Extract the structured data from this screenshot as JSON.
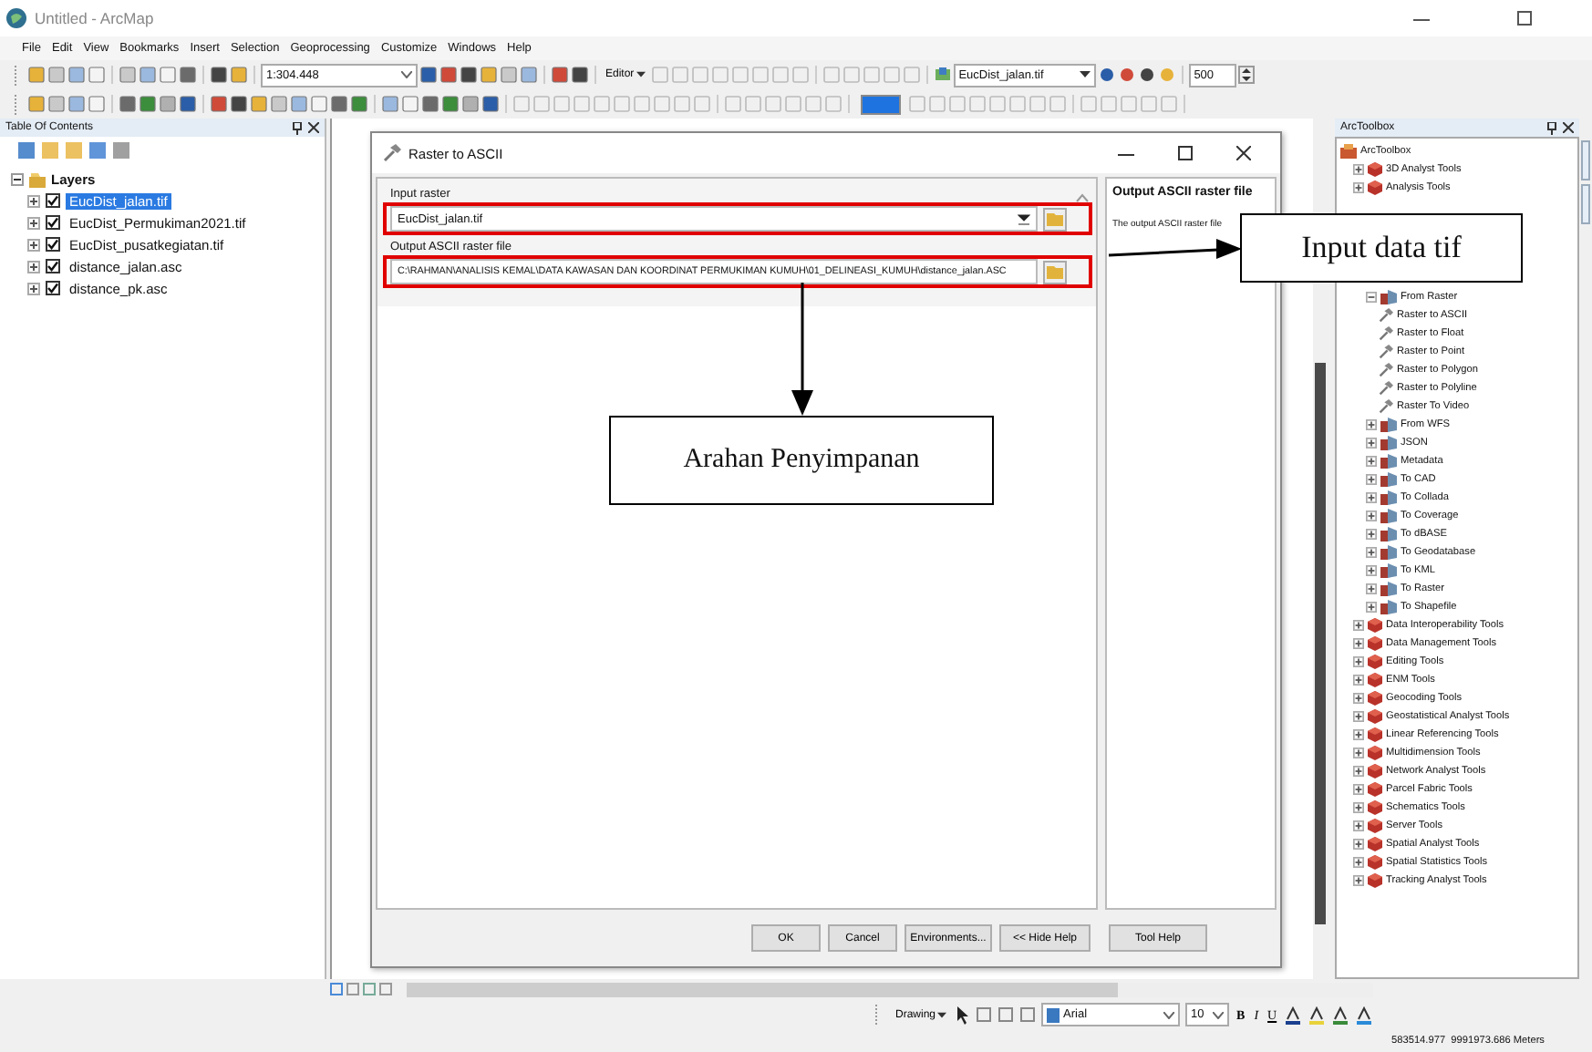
{
  "window": {
    "title": "Untitled - ArcMap"
  },
  "menu": [
    "File",
    "Edit",
    "View",
    "Bookmarks",
    "Insert",
    "Selection",
    "Geoprocessing",
    "Customize",
    "Windows",
    "Help"
  ],
  "toolbar": {
    "scale": "1:304.448",
    "editor": "Editor",
    "layer": "EucDist_jalan.tif",
    "value": "500"
  },
  "table_of_contents": {
    "title": "Table Of Contents",
    "group": {
      "label": "Layers",
      "expanded": true,
      "children": [
        {
          "label": "EucDist_jalan.tif",
          "checked": true,
          "selected": true
        },
        {
          "label": "EucDist_Permukiman2021.tif",
          "checked": true,
          "selected": false
        },
        {
          "label": "EucDist_pusatkegiatan.tif",
          "checked": true,
          "selected": false
        },
        {
          "label": "distance_jalan.asc",
          "checked": true,
          "selected": false
        },
        {
          "label": "distance_pk.asc",
          "checked": true,
          "selected": false
        }
      ]
    }
  },
  "dialog": {
    "title": "Raster to ASCII",
    "fields": [
      {
        "kind": "dropdown",
        "label": "Input raster",
        "value": "EucDist_jalan.tif",
        "highlighted": true
      },
      {
        "kind": "path",
        "label": "Output ASCII raster file",
        "value": "C:\\RAHMAN\\ANALISIS KEMAL\\DATA KAWASAN DAN KOORDINAT PERMUKIMAN KUMUH\\01_DELINEASI_KUMUH\\distance_jalan.ASC",
        "highlighted": true
      }
    ],
    "help": {
      "heading": "Output ASCII raster file",
      "text": "The output ASCII raster file"
    },
    "buttons": [
      "OK",
      "Cancel",
      "Environments...",
      "<< Hide Help",
      "Tool Help"
    ]
  },
  "toolbox": {
    "title": "ArcToolbox",
    "root": {
      "label": "ArcToolbox",
      "kind": "root",
      "children": [
        {
          "label": "3D Analyst Tools",
          "kind": "toolbox",
          "expanded": false
        },
        {
          "label": "Analysis Tools",
          "kind": "toolbox",
          "expanded": false
        },
        {
          "kind": "covered"
        },
        {
          "kind": "covered",
          "children": [
            {
              "kind": "covered"
            },
            {
              "kind": "covered"
            },
            {
              "kind": "covered"
            },
            {
              "label": "From Raster",
              "kind": "toolset",
              "expanded": true,
              "children": [
                {
                  "label": "Raster to ASCII",
                  "kind": "tool"
                },
                {
                  "label": "Raster to Float",
                  "kind": "tool"
                },
                {
                  "label": "Raster to Point",
                  "kind": "tool"
                },
                {
                  "label": "Raster to Polygon",
                  "kind": "tool"
                },
                {
                  "label": "Raster to Polyline",
                  "kind": "tool"
                },
                {
                  "label": "Raster To Video",
                  "kind": "tool"
                }
              ]
            },
            {
              "label": "From WFS",
              "kind": "toolset",
              "expanded": false
            },
            {
              "label": "JSON",
              "kind": "toolset",
              "expanded": false
            },
            {
              "label": "Metadata",
              "kind": "toolset",
              "expanded": false
            },
            {
              "label": "To CAD",
              "kind": "toolset",
              "expanded": false
            },
            {
              "label": "To Collada",
              "kind": "toolset",
              "expanded": false
            },
            {
              "label": "To Coverage",
              "kind": "toolset",
              "expanded": false
            },
            {
              "label": "To dBASE",
              "kind": "toolset",
              "expanded": false
            },
            {
              "label": "To Geodatabase",
              "kind": "toolset",
              "expanded": false
            },
            {
              "label": "To KML",
              "kind": "toolset",
              "expanded": false
            },
            {
              "label": "To Raster",
              "kind": "toolset",
              "expanded": false
            },
            {
              "label": "To Shapefile",
              "kind": "toolset",
              "expanded": false
            }
          ]
        },
        {
          "label": "Data Interoperability Tools",
          "kind": "toolbox",
          "expanded": false
        },
        {
          "label": "Data Management Tools",
          "kind": "toolbox",
          "expanded": false
        },
        {
          "label": "Editing Tools",
          "kind": "toolbox",
          "expanded": false
        },
        {
          "label": "ENM Tools",
          "kind": "toolbox",
          "expanded": false
        },
        {
          "label": "Geocoding Tools",
          "kind": "toolbox",
          "expanded": false
        },
        {
          "label": "Geostatistical Analyst Tools",
          "kind": "toolbox",
          "expanded": false
        },
        {
          "label": "Linear Referencing Tools",
          "kind": "toolbox",
          "expanded": false
        },
        {
          "label": "Multidimension Tools",
          "kind": "toolbox",
          "expanded": false
        },
        {
          "label": "Network Analyst Tools",
          "kind": "toolbox",
          "expanded": false
        },
        {
          "label": "Parcel Fabric Tools",
          "kind": "toolbox",
          "expanded": false
        },
        {
          "label": "Schematics Tools",
          "kind": "toolbox",
          "expanded": false
        },
        {
          "label": "Server Tools",
          "kind": "toolbox",
          "expanded": false
        },
        {
          "label": "Spatial Analyst Tools",
          "kind": "toolbox",
          "expanded": false
        },
        {
          "label": "Spatial Statistics Tools",
          "kind": "toolbox",
          "expanded": false
        },
        {
          "label": "Tracking Analyst Tools",
          "kind": "toolbox",
          "expanded": false
        }
      ]
    }
  },
  "drawing_toolbar": {
    "label": "Drawing",
    "font": "Arial",
    "size": "10",
    "styles": [
      "B",
      "I",
      "U"
    ]
  },
  "status_bar": {
    "coordinates": "583514.977  9991973.686 Meters"
  },
  "annotations": [
    {
      "kind": "right",
      "text": "Input data tif"
    },
    {
      "kind": "down",
      "text": "Arahan Penyimpanan"
    }
  ]
}
